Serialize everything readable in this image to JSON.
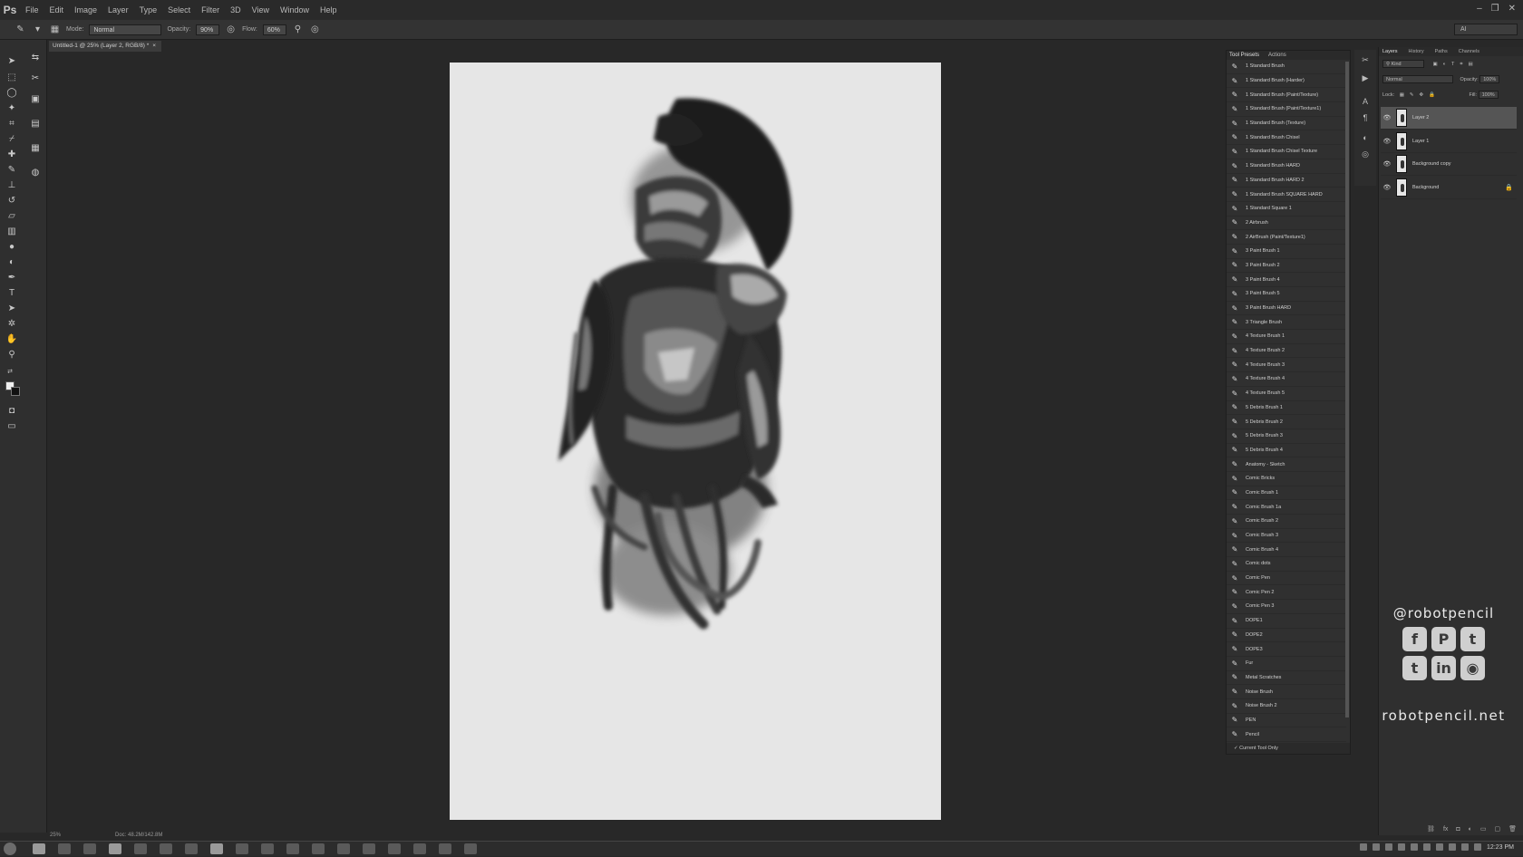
{
  "app": {
    "logo": "Ps"
  },
  "menu": [
    "File",
    "Edit",
    "Image",
    "Layer",
    "Type",
    "Select",
    "Filter",
    "3D",
    "View",
    "Window",
    "Help"
  ],
  "window_controls": {
    "minimize": "‒",
    "restore": "❐",
    "close": "✕"
  },
  "options": {
    "mode_label": "Mode:",
    "mode_value": "Normal",
    "opacity_label": "Opacity:",
    "opacity_value": "90%",
    "flow_label": "Flow:",
    "flow_value": "60%",
    "workspace": "AI"
  },
  "document": {
    "tab_title": "Untitled-1 @ 25% (Layer 2, RGB/8) *",
    "tab_close": "×",
    "zoom": "25%",
    "doc_size": "Doc: 48.2M/142.8M"
  },
  "tool_presets": {
    "tabs": [
      "Tool Presets",
      "Actions"
    ],
    "items": [
      "1 Standard Brush",
      "1 Standard Brush (Harder)",
      "1 Standard Brush (Paint/Texture)",
      "1 Standard Brush (Paint/Texture1)",
      "1 Standard Brush (Texture)",
      "1 Standard Brush Chisel",
      "1 Standard Brush Chisel Texture",
      "1 Standard Brush HARD",
      "1 Standard Brush HARD 2",
      "1 Standard Brush SQUARE HARD",
      "1 Standard Square 1",
      "2 Airbrush",
      "2 AirBrush (Paint/Texture1)",
      "3 Paint Brush 1",
      "3 Paint Brush 2",
      "3 Paint Brush 4",
      "3 Paint Brush 5",
      "3 Paint Brush HARD",
      "3 Triangle Brush",
      "4 Texture Brush 1",
      "4 Texture Brush 2",
      "4 Texture Brush 3",
      "4 Texture Brush 4",
      "4 Texture Brush 5",
      "5 Debris Brush 1",
      "5 Debris Brush 2",
      "5 Debris Brush 3",
      "5 Debris Brush 4",
      "Anatomy - Sketch",
      "Comic Bricks",
      "Comic Brush 1",
      "Comic Brush 1a",
      "Comic Brush 2",
      "Comic Brush 3",
      "Comic Brush 4",
      "Comic dots",
      "Comic Pen",
      "Comic Pen 2",
      "Comic Pen 3",
      "DOPE1",
      "DOPE2",
      "DOPE3",
      "Fur",
      "Metal Scratches",
      "Noise Brush",
      "Noise Brush 2",
      "PEN",
      "Pencil"
    ],
    "footer": "Current Tool Only"
  },
  "layers": {
    "tabs": [
      "Layers",
      "History",
      "Paths",
      "Channels"
    ],
    "filter": "Kind",
    "blend_mode": "Normal",
    "opacity_label": "Opacity:",
    "opacity_value": "100%",
    "lock_label": "Lock:",
    "fill_label": "Fill:",
    "fill_value": "100%",
    "items": [
      {
        "name": "Layer 2",
        "selected": true
      },
      {
        "name": "Layer 1",
        "selected": false
      },
      {
        "name": "Background copy",
        "selected": false
      },
      {
        "name": "Background",
        "selected": false
      }
    ]
  },
  "watermark": {
    "handle": "@robotpencil",
    "icons": [
      "f",
      "P",
      "t",
      "t",
      "in",
      "◉"
    ],
    "site": "robotpencil.net"
  },
  "taskbar": {
    "clock": "12:23 PM"
  },
  "colors": {
    "foreground": "#f0f0f0",
    "background": "#111111",
    "canvas": "#e6e6e6"
  }
}
